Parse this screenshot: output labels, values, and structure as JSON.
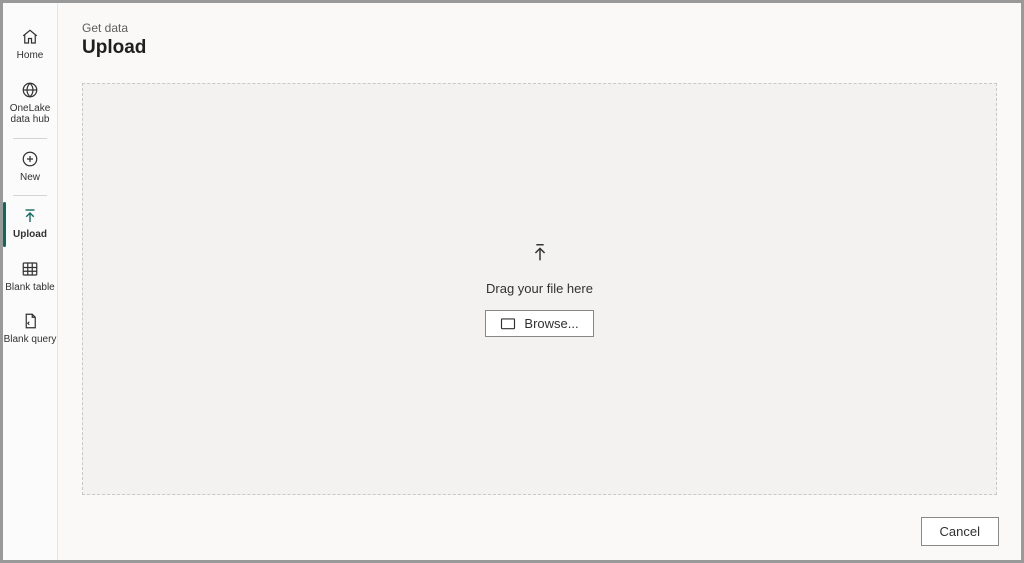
{
  "sidebar": {
    "items": [
      {
        "label": "Home"
      },
      {
        "label": "OneLake\ndata hub"
      },
      {
        "label": "New"
      },
      {
        "label": "Upload"
      },
      {
        "label": "Blank table"
      },
      {
        "label": "Blank query"
      }
    ]
  },
  "header": {
    "breadcrumb": "Get data",
    "title": "Upload"
  },
  "dropzone": {
    "text": "Drag your file here",
    "browse_label": "Browse..."
  },
  "footer": {
    "cancel_label": "Cancel"
  }
}
